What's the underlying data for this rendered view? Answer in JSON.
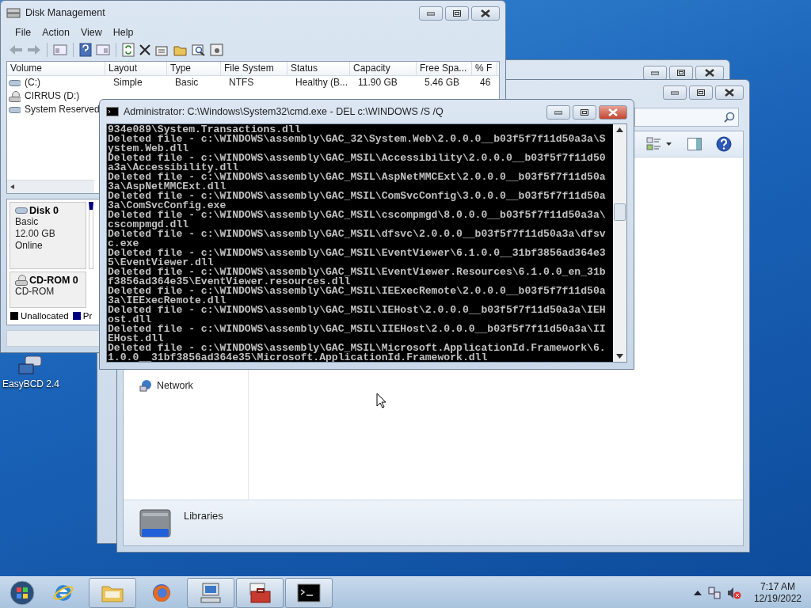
{
  "desktop_icons": [
    {
      "label": "EasyBCD 2.4"
    }
  ],
  "explorer": {
    "nav_items": [
      {
        "label": "Network"
      }
    ],
    "details": {
      "title": "Libraries"
    }
  },
  "disk_management": {
    "title": "Disk Management",
    "menu": [
      "File",
      "Action",
      "View",
      "Help"
    ],
    "table": {
      "columns": [
        "Volume",
        "Layout",
        "Type",
        "File System",
        "Status",
        "Capacity",
        "Free Spa...",
        "% F"
      ],
      "rows": [
        {
          "kind": "disk",
          "cells": [
            "(C:)",
            "Simple",
            "Basic",
            "NTFS",
            "Healthy (B...",
            "11.90 GB",
            "5.46 GB",
            "46"
          ]
        },
        {
          "kind": "cd",
          "cells": [
            "CIRRUS (D:)"
          ]
        },
        {
          "kind": "disk",
          "cells": [
            "System Reserved"
          ]
        }
      ]
    },
    "disks": [
      {
        "kind": "disk",
        "name": "Disk 0",
        "lines": [
          "Basic",
          "12.00 GB",
          "Online"
        ]
      },
      {
        "kind": "cd",
        "name": "CD-ROM 0",
        "lines": [
          "CD-ROM"
        ]
      }
    ],
    "legend": [
      {
        "label": "Unallocated",
        "color": "#000000"
      },
      {
        "label": "Pr",
        "color": "#000080"
      }
    ]
  },
  "cmd": {
    "title": "Administrator: C:\\Windows\\System32\\cmd.exe - DEL  c:\\WINDOWS /S /Q",
    "lines": [
      "934e089\\System.Transactions.dll",
      "Deleted file - c:\\WINDOWS\\assembly\\GAC_32\\System.Web\\2.0.0.0__b03f5f7f11d50a3a\\S",
      "ystem.Web.dll",
      "Deleted file - c:\\WINDOWS\\assembly\\GAC_MSIL\\Accessibility\\2.0.0.0__b03f5f7f11d50",
      "a3a\\Accessibility.dll",
      "Deleted file - c:\\WINDOWS\\assembly\\GAC_MSIL\\AspNetMMCExt\\2.0.0.0__b03f5f7f11d50a",
      "3a\\AspNetMMCExt.dll",
      "Deleted file - c:\\WINDOWS\\assembly\\GAC_MSIL\\ComSvcConfig\\3.0.0.0__b03f5f7f11d50a",
      "3a\\ComSvcConfig.exe",
      "Deleted file - c:\\WINDOWS\\assembly\\GAC_MSIL\\cscompmgd\\8.0.0.0__b03f5f7f11d50a3a\\",
      "cscompmgd.dll",
      "Deleted file - c:\\WINDOWS\\assembly\\GAC_MSIL\\dfsvc\\2.0.0.0__b03f5f7f11d50a3a\\dfsv",
      "c.exe",
      "Deleted file - c:\\WINDOWS\\assembly\\GAC_MSIL\\EventViewer\\6.1.0.0__31bf3856ad364e3",
      "5\\EventViewer.dll",
      "Deleted file - c:\\WINDOWS\\assembly\\GAC_MSIL\\EventViewer.Resources\\6.1.0.0_en_31b",
      "f3856ad364e35\\EventViewer.resources.dll",
      "Deleted file - c:\\WINDOWS\\assembly\\GAC_MSIL\\IEExecRemote\\2.0.0.0__b03f5f7f11d50a",
      "3a\\IEExecRemote.dll",
      "Deleted file - c:\\WINDOWS\\assembly\\GAC_MSIL\\IEHost\\2.0.0.0__b03f5f7f11d50a3a\\IEH",
      "ost.dll",
      "Deleted file - c:\\WINDOWS\\assembly\\GAC_MSIL\\IIEHost\\2.0.0.0__b03f5f7f11d50a3a\\II",
      "EHost.dll",
      "Deleted file - c:\\WINDOWS\\assembly\\GAC_MSIL\\Microsoft.ApplicationId.Framework\\6.",
      "1.0.0__31bf3856ad364e35\\Microsoft.ApplicationId.Framework.dll"
    ]
  },
  "taskbar": {
    "items": [
      {
        "kind": "ie",
        "running": false
      },
      {
        "kind": "folder",
        "running": true
      },
      {
        "kind": "firefox",
        "running": false
      },
      {
        "kind": "computer",
        "running": true
      },
      {
        "kind": "toolbox",
        "running": true
      },
      {
        "kind": "console",
        "running": true
      }
    ],
    "clock": {
      "time": "7:17 AM",
      "date": "12/19/2022"
    }
  }
}
